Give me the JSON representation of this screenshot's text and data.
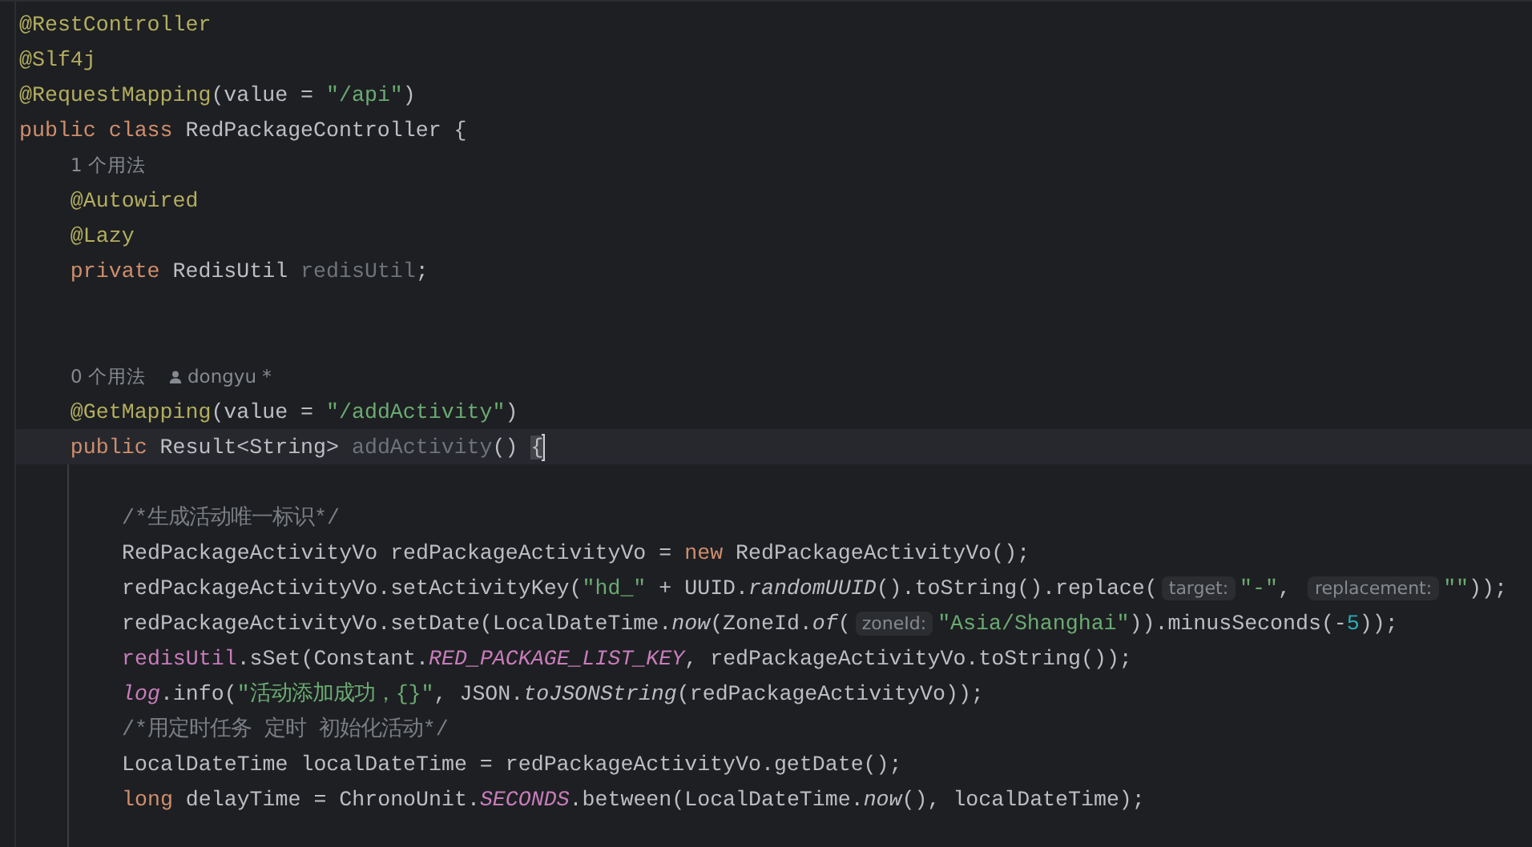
{
  "editor": {
    "lines": [
      {
        "kind": "code",
        "current": false,
        "tokens": [
          {
            "kind": "annotation",
            "text": "@RestController"
          }
        ]
      },
      {
        "kind": "code",
        "current": false,
        "tokens": [
          {
            "kind": "annotation",
            "text": "@Slf4j"
          }
        ]
      },
      {
        "kind": "code",
        "current": false,
        "tokens": [
          {
            "kind": "annotation",
            "text": "@RequestMapping"
          },
          {
            "kind": "plain",
            "text": "(value = "
          },
          {
            "kind": "string",
            "text": "\"/api\""
          },
          {
            "kind": "plain",
            "text": ")"
          }
        ]
      },
      {
        "kind": "code",
        "current": false,
        "tokens": [
          {
            "kind": "keyword",
            "text": "public class "
          },
          {
            "kind": "plain",
            "text": "RedPackageController {"
          }
        ]
      },
      {
        "kind": "usages",
        "current": false,
        "text": "1 个用法"
      },
      {
        "kind": "code",
        "current": false,
        "tokens": [
          {
            "kind": "annotation",
            "text": "    @Autowired"
          }
        ]
      },
      {
        "kind": "code",
        "current": false,
        "tokens": [
          {
            "kind": "annotation",
            "text": "    @Lazy"
          }
        ]
      },
      {
        "kind": "code",
        "current": false,
        "tokens": [
          {
            "kind": "keyword",
            "text": "    private "
          },
          {
            "kind": "plain",
            "text": "RedisUtil "
          },
          {
            "kind": "unused",
            "text": "redisUtil"
          },
          {
            "kind": "plain",
            "text": ";"
          }
        ]
      },
      {
        "kind": "blank",
        "current": false
      },
      {
        "kind": "blank",
        "current": false
      },
      {
        "kind": "usages",
        "current": false,
        "text": "0 个用法",
        "author": "dongyu *"
      },
      {
        "kind": "code",
        "current": false,
        "tokens": [
          {
            "kind": "annotation",
            "text": "    @GetMapping"
          },
          {
            "kind": "plain",
            "text": "(value = "
          },
          {
            "kind": "string",
            "text": "\"/addActivity\""
          },
          {
            "kind": "plain",
            "text": ")"
          }
        ]
      },
      {
        "kind": "code",
        "current": true,
        "tokens": [
          {
            "kind": "keyword",
            "text": "    public "
          },
          {
            "kind": "plain",
            "text": "Result<String> "
          },
          {
            "kind": "unused",
            "text": "addActivity"
          },
          {
            "kind": "plain",
            "text": "() "
          },
          {
            "kind": "brace_at_cursor",
            "text": "{"
          }
        ],
        "children": [
          {
            "kind": "blank",
            "current": false
          },
          {
            "kind": "code",
            "current": false,
            "tokens": [
              {
                "kind": "comment",
                "text": "/*生成活动唯一标识*/"
              }
            ]
          },
          {
            "kind": "code",
            "current": false,
            "tokens": [
              {
                "kind": "plain",
                "text": "RedPackageActivityVo redPackageActivityVo = "
              },
              {
                "kind": "keyword",
                "text": "new "
              },
              {
                "kind": "plain",
                "text": "RedPackageActivityVo();"
              }
            ]
          },
          {
            "kind": "code",
            "current": false,
            "tokens": [
              {
                "kind": "plain",
                "text": "redPackageActivityVo.setActivityKey("
              },
              {
                "kind": "string",
                "text": "\"hd_\""
              },
              {
                "kind": "plain",
                "text": " + UUID."
              },
              {
                "kind": "static_method",
                "text": "randomUUID"
              },
              {
                "kind": "plain",
                "text": "().toString().replace("
              },
              {
                "kind": "hint",
                "text": "target:"
              },
              {
                "kind": "string",
                "text": "\"-\""
              },
              {
                "kind": "plain",
                "text": ", "
              },
              {
                "kind": "hint",
                "text": "replacement:"
              },
              {
                "kind": "string",
                "text": "\"\""
              },
              {
                "kind": "plain",
                "text": "));"
              }
            ]
          },
          {
            "kind": "code",
            "current": false,
            "tokens": [
              {
                "kind": "plain",
                "text": "redPackageActivityVo.setDate(LocalDateTime."
              },
              {
                "kind": "static_method",
                "text": "now"
              },
              {
                "kind": "plain",
                "text": "(ZoneId."
              },
              {
                "kind": "static_method",
                "text": "of"
              },
              {
                "kind": "plain",
                "text": "("
              },
              {
                "kind": "hint",
                "text": "zoneId:"
              },
              {
                "kind": "string",
                "text": "\"Asia/Shanghai\""
              },
              {
                "kind": "plain",
                "text": ")).minusSeconds(-"
              },
              {
                "kind": "number",
                "text": "5"
              },
              {
                "kind": "plain",
                "text": "));"
              }
            ]
          },
          {
            "kind": "code",
            "current": false,
            "tokens": [
              {
                "kind": "field",
                "text": "redisUtil"
              },
              {
                "kind": "plain",
                "text": ".sSet(Constant."
              },
              {
                "kind": "constant",
                "text": "RED_PACKAGE_LIST_KEY"
              },
              {
                "kind": "plain",
                "text": ", redPackageActivityVo.toString());"
              }
            ]
          },
          {
            "kind": "code",
            "current": false,
            "tokens": [
              {
                "kind": "field_italic",
                "text": "log"
              },
              {
                "kind": "plain",
                "text": ".info("
              },
              {
                "kind": "string",
                "text": "\"活动添加成功，{}\""
              },
              {
                "kind": "plain",
                "text": ", JSON."
              },
              {
                "kind": "static_method",
                "text": "toJSONString"
              },
              {
                "kind": "plain",
                "text": "(redPackageActivityVo));"
              }
            ]
          },
          {
            "kind": "code",
            "current": false,
            "tokens": [
              {
                "kind": "comment",
                "text": "/*用定时任务 定时 初始化活动*/"
              }
            ]
          },
          {
            "kind": "code",
            "current": false,
            "tokens": [
              {
                "kind": "plain",
                "text": "LocalDateTime localDateTime = redPackageActivityVo.getDate();"
              }
            ]
          },
          {
            "kind": "code",
            "current": false,
            "tokens": [
              {
                "kind": "keyword",
                "text": "long "
              },
              {
                "kind": "plain",
                "text": "delayTime = ChronoUnit."
              },
              {
                "kind": "constant",
                "text": "SECONDS"
              },
              {
                "kind": "plain",
                "text": ".between(LocalDateTime."
              },
              {
                "kind": "static_method",
                "text": "now"
              },
              {
                "kind": "plain",
                "text": "(), localDateTime);"
              }
            ]
          },
          {
            "kind": "blank",
            "current": false
          }
        ]
      }
    ]
  }
}
